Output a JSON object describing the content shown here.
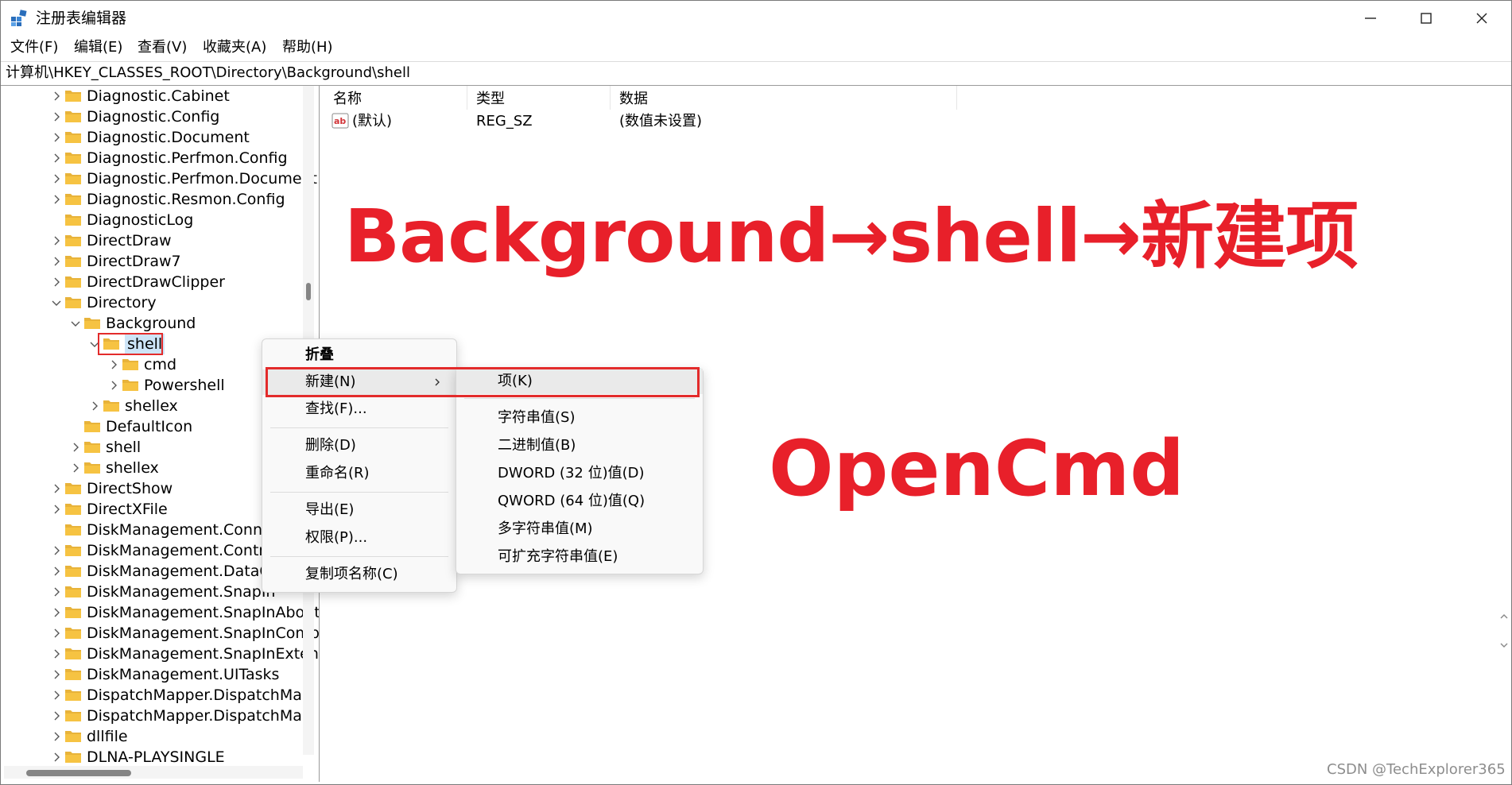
{
  "window": {
    "title": "注册表编辑器",
    "controls": [
      "minimize-icon",
      "maximize-icon",
      "close-icon"
    ]
  },
  "menubar": {
    "items": [
      {
        "label": "文件(F)"
      },
      {
        "label": "编辑(E)"
      },
      {
        "label": "查看(V)"
      },
      {
        "label": "收藏夹(A)"
      },
      {
        "label": "帮助(H)"
      }
    ]
  },
  "address": {
    "path": "计算机\\HKEY_CLASSES_ROOT\\Directory\\Background\\shell"
  },
  "tree": {
    "items": [
      {
        "label": "Diagnostic.Cabinet",
        "depth": 0,
        "expander": "collapsed"
      },
      {
        "label": "Diagnostic.Config",
        "depth": 0,
        "expander": "collapsed"
      },
      {
        "label": "Diagnostic.Document",
        "depth": 0,
        "expander": "collapsed"
      },
      {
        "label": "Diagnostic.Perfmon.Config",
        "depth": 0,
        "expander": "collapsed"
      },
      {
        "label": "Diagnostic.Perfmon.Document",
        "depth": 0,
        "expander": "collapsed"
      },
      {
        "label": "Diagnostic.Resmon.Config",
        "depth": 0,
        "expander": "collapsed"
      },
      {
        "label": "DiagnosticLog",
        "depth": 0,
        "expander": "none"
      },
      {
        "label": "DirectDraw",
        "depth": 0,
        "expander": "collapsed"
      },
      {
        "label": "DirectDraw7",
        "depth": 0,
        "expander": "collapsed"
      },
      {
        "label": "DirectDrawClipper",
        "depth": 0,
        "expander": "collapsed"
      },
      {
        "label": "Directory",
        "depth": 0,
        "expander": "expanded"
      },
      {
        "label": "Background",
        "depth": 1,
        "expander": "expanded"
      },
      {
        "label": "shell",
        "depth": 2,
        "expander": "expanded",
        "selected": true
      },
      {
        "label": "cmd",
        "depth": 3,
        "expander": "collapsed"
      },
      {
        "label": "Powershell",
        "depth": 3,
        "expander": "collapsed"
      },
      {
        "label": "shellex",
        "depth": 2,
        "expander": "collapsed"
      },
      {
        "label": "DefaultIcon",
        "depth": 1,
        "expander": "none"
      },
      {
        "label": "shell",
        "depth": 1,
        "expander": "collapsed"
      },
      {
        "label": "shellex",
        "depth": 1,
        "expander": "collapsed"
      },
      {
        "label": "DirectShow",
        "depth": 0,
        "expander": "collapsed"
      },
      {
        "label": "DirectXFile",
        "depth": 0,
        "expander": "collapsed"
      },
      {
        "label": "DiskManagement.Connec",
        "depth": 0,
        "expander": "none"
      },
      {
        "label": "DiskManagement.Control",
        "depth": 0,
        "expander": "collapsed"
      },
      {
        "label": "DiskManagement.DataOb",
        "depth": 0,
        "expander": "collapsed"
      },
      {
        "label": "DiskManagement.SnapIn",
        "depth": 0,
        "expander": "collapsed"
      },
      {
        "label": "DiskManagement.SnapInAbout",
        "depth": 0,
        "expander": "collapsed"
      },
      {
        "label": "DiskManagement.SnapInComp",
        "depth": 0,
        "expander": "collapsed"
      },
      {
        "label": "DiskManagement.SnapInExtens",
        "depth": 0,
        "expander": "collapsed"
      },
      {
        "label": "DiskManagement.UITasks",
        "depth": 0,
        "expander": "collapsed"
      },
      {
        "label": "DispatchMapper.DispatchMap",
        "depth": 0,
        "expander": "collapsed"
      },
      {
        "label": "DispatchMapper.DispatchMap",
        "depth": 0,
        "expander": "collapsed"
      },
      {
        "label": "dllfile",
        "depth": 0,
        "expander": "collapsed"
      },
      {
        "label": "DLNA-PLAYSINGLE",
        "depth": 0,
        "expander": "collapsed"
      }
    ]
  },
  "values": {
    "columns": {
      "name": "名称",
      "type": "类型",
      "data": "数据"
    },
    "rows": [
      {
        "name": "(默认)",
        "type": "REG_SZ",
        "data": "(数值未设置)",
        "icon": "string-value-icon"
      }
    ]
  },
  "context_menu": {
    "header": "折叠",
    "groups": [
      [
        {
          "label": "新建(N)",
          "submenu": true,
          "highlighted": true
        },
        {
          "label": "查找(F)..."
        }
      ],
      [
        {
          "label": "删除(D)"
        },
        {
          "label": "重命名(R)"
        }
      ],
      [
        {
          "label": "导出(E)"
        },
        {
          "label": "权限(P)..."
        }
      ],
      [
        {
          "label": "复制项名称(C)"
        }
      ]
    ]
  },
  "submenu": {
    "items": [
      {
        "label": "项(K)",
        "highlighted": true
      },
      {
        "label": "字符串值(S)"
      },
      {
        "label": "二进制值(B)"
      },
      {
        "label": "DWORD (32 位)值(D)"
      },
      {
        "label": "QWORD (64 位)值(Q)"
      },
      {
        "label": "多字符串值(M)"
      },
      {
        "label": "可扩充字符串值(E)"
      }
    ]
  },
  "annotations": {
    "line1": "Background→shell→新建项",
    "line2": "OpenCmd",
    "color": "#e8202a"
  },
  "watermark": "CSDN @TechExplorer365",
  "colors": {
    "highlight_border": "#e32b2b",
    "selection_fill": "#cde4f7",
    "folder": "#f6c342"
  }
}
